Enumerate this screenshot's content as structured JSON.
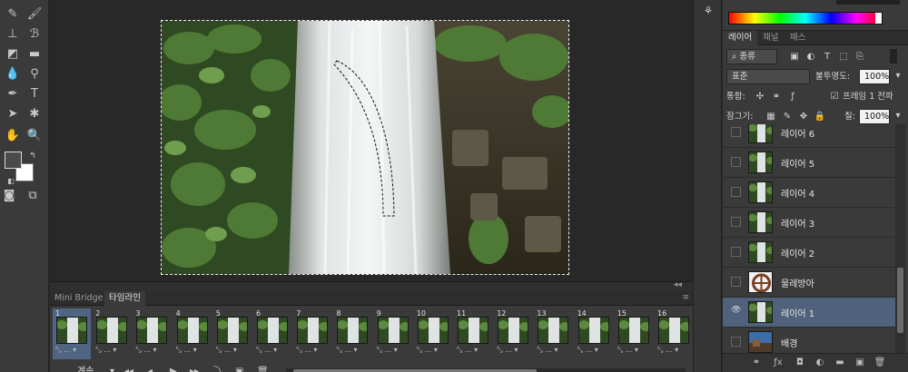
{
  "tools": {
    "icons": [
      "healing-brush-icon",
      "brush-icon",
      "clone-stamp-icon",
      "history-brush-icon",
      "eraser-icon",
      "gradient-icon",
      "blur-icon",
      "dodge-icon",
      "pen-icon",
      "type-icon",
      "path-selection-icon",
      "shape-icon",
      "hand-icon",
      "zoom-icon"
    ]
  },
  "animation": {
    "tabs": [
      "Mini Bridge",
      "타임라인"
    ],
    "active_tab": 1,
    "frames": [
      {
        "num": "1",
        "delay": "..."
      },
      {
        "num": "2",
        "delay": "..."
      },
      {
        "num": "3",
        "delay": "..."
      },
      {
        "num": "4",
        "delay": "..."
      },
      {
        "num": "5",
        "delay": "..."
      },
      {
        "num": "6",
        "delay": "..."
      },
      {
        "num": "7",
        "delay": "..."
      },
      {
        "num": "8",
        "delay": "..."
      },
      {
        "num": "9",
        "delay": "..."
      },
      {
        "num": "10",
        "delay": "..."
      },
      {
        "num": "11",
        "delay": "..."
      },
      {
        "num": "12",
        "delay": "..."
      },
      {
        "num": "13",
        "delay": "..."
      },
      {
        "num": "14",
        "delay": "..."
      },
      {
        "num": "15",
        "delay": "..."
      },
      {
        "num": "16",
        "delay": "..."
      }
    ],
    "loop_label": "계속"
  },
  "layers": {
    "tabs": [
      "레이어",
      "채널",
      "패스"
    ],
    "filter_kind": "종류",
    "blend_mode": "표준",
    "opacity_label": "불투명도:",
    "opacity_value": "100%",
    "unify_label": "통합:",
    "propagate_label": "프레임 1 전파",
    "lock_label": "잠그기:",
    "fill_label": "칠:",
    "fill_value": "100%",
    "items": [
      {
        "name": "레이어 6",
        "visible": false,
        "thumb": "waterfall",
        "selected": false
      },
      {
        "name": "레이어 5",
        "visible": false,
        "thumb": "waterfall",
        "selected": false
      },
      {
        "name": "레이어 4",
        "visible": false,
        "thumb": "waterfall",
        "selected": false
      },
      {
        "name": "레이어 3",
        "visible": false,
        "thumb": "waterfall",
        "selected": false
      },
      {
        "name": "레이어 2",
        "visible": false,
        "thumb": "waterfall",
        "selected": false
      },
      {
        "name": "물레방아",
        "visible": false,
        "thumb": "waterwheel",
        "selected": false
      },
      {
        "name": "레이어 1",
        "visible": true,
        "thumb": "waterfall",
        "selected": true
      },
      {
        "name": "배경",
        "visible": false,
        "thumb": "landscape",
        "selected": false
      }
    ]
  },
  "colors": {
    "selection": "#50617b",
    "frame_selected": "#4f6583"
  }
}
